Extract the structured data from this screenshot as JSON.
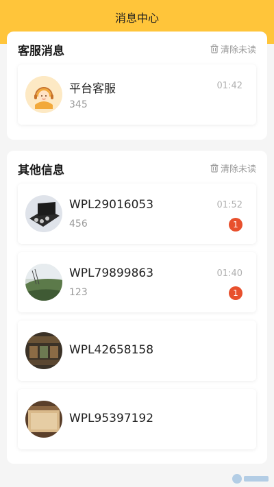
{
  "header": {
    "title": "消息中心",
    "accent": "#ffc53a"
  },
  "service": {
    "title": "客服消息",
    "clear_label": "清除未读",
    "items": [
      {
        "name": "平台客服",
        "preview": "345",
        "time": "01:42"
      }
    ]
  },
  "other": {
    "title": "其他信息",
    "clear_label": "清除未读",
    "items": [
      {
        "name": "WPL29016053",
        "preview": "456",
        "time": "01:52",
        "badge": "1"
      },
      {
        "name": "WPL79899863",
        "preview": "123",
        "time": "01:40",
        "badge": "1"
      },
      {
        "name": "WPL42658158"
      },
      {
        "name": "WPL95397192"
      }
    ]
  },
  "colors": {
    "badge": "#e8502d",
    "accent": "#ffc53a"
  },
  "icons": [
    "trash-icon",
    "customer-service-avatar"
  ]
}
